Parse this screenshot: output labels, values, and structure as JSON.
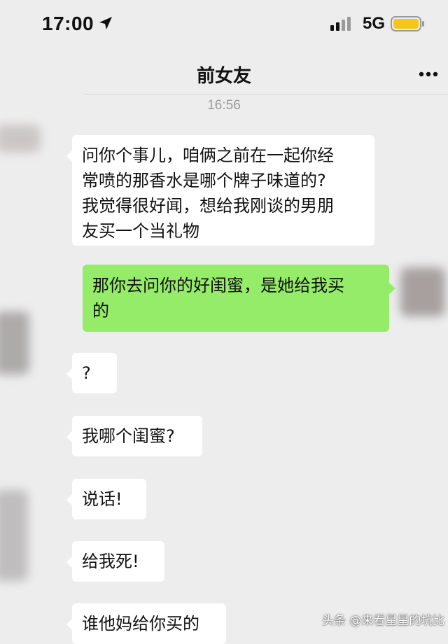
{
  "status_bar": {
    "time": "17:00",
    "network": "5G",
    "icons": [
      "location-arrow-icon",
      "signal-icon",
      "battery-icon"
    ],
    "battery_color": "#f5c518"
  },
  "nav": {
    "title": "前女友",
    "more_icon": "more-dots-icon"
  },
  "chat": {
    "timestamp": "16:56",
    "messages": [
      {
        "side": "in",
        "lines": [
          "问你个事儿，咱俩之前在一起你经",
          "常喷的那香水是哪个牌子味道的?",
          "我觉得很好闻，想给我刚谈的男朋",
          "友买一个当礼物"
        ]
      },
      {
        "side": "out",
        "lines": [
          "那你去问你的好闺蜜，是她给我买",
          "的"
        ]
      },
      {
        "side": "in",
        "lines": [
          "?"
        ]
      },
      {
        "side": "in",
        "lines": [
          "我哪个闺蜜?"
        ]
      },
      {
        "side": "in",
        "lines": [
          "说话!"
        ]
      },
      {
        "side": "in",
        "lines": [
          "给我死!"
        ]
      },
      {
        "side": "in",
        "lines": [
          "谁他妈给你买的"
        ]
      }
    ],
    "colors": {
      "background": "#ededed",
      "incoming_bubble": "#ffffff",
      "outgoing_bubble": "#95ec69"
    }
  },
  "watermark": "头条 @来看星星的坑比"
}
